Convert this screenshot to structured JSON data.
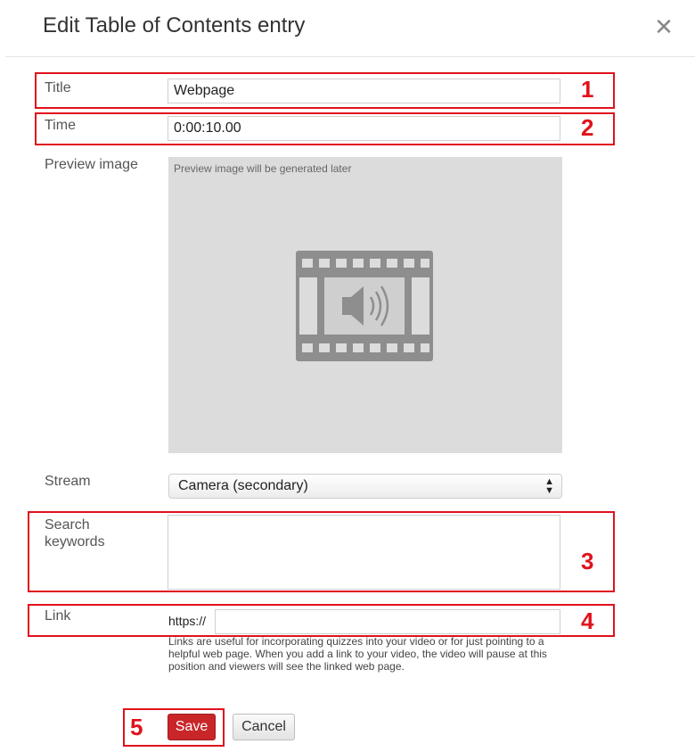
{
  "dialog": {
    "title": "Edit Table of Contents entry",
    "close_icon": "close-icon"
  },
  "form": {
    "title_label": "Title",
    "title_value": "Webpage",
    "time_label": "Time",
    "time_value": "0:00:10.00",
    "preview_label": "Preview image",
    "preview_placeholder": "Preview image will be generated later",
    "preview_icon": "video-audio-filmstrip-icon",
    "stream_label": "Stream",
    "stream_value": "Camera (secondary)",
    "keywords_label": "Search keywords",
    "keywords_value": "",
    "link_label": "Link",
    "link_prefix": "https://",
    "link_value": "",
    "link_help": "Links are useful for incorporating quizzes into your video or for just pointing to a helpful web page. When you add a link to your video, the video will pause at this position and viewers will see the linked web page."
  },
  "buttons": {
    "save": "Save",
    "cancel": "Cancel"
  },
  "annotations": {
    "n1": "1",
    "n2": "2",
    "n3": "3",
    "n4": "4",
    "n5": "5",
    "color": "#e0121c"
  }
}
